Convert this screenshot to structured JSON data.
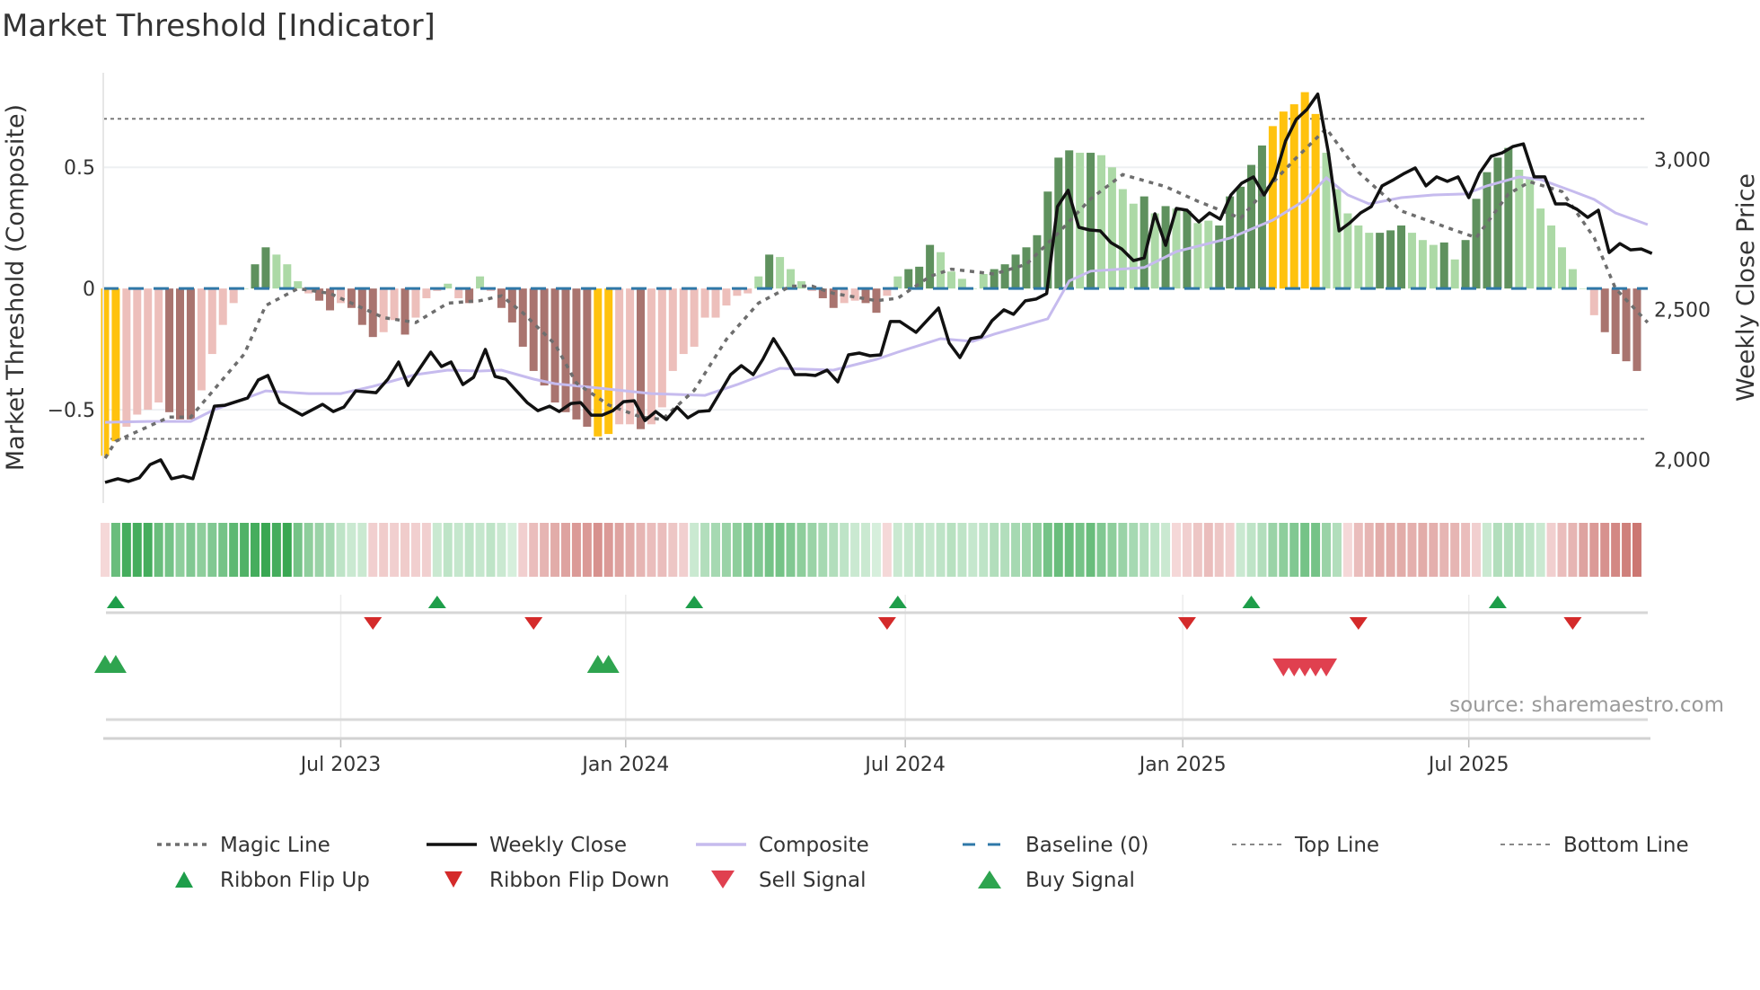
{
  "title": "Market Threshold [Indicator]",
  "source": "source: sharemaestro.com",
  "colors": {
    "yellow": "#FFC20E",
    "dark_green": "#5f915e",
    "light_green": "#acd9a6",
    "dark_red": "#a9746f",
    "light_red": "#edbfbb",
    "baseline": "#2f78a8",
    "magic": "#6e6e6e",
    "close": "#111111",
    "composite": "#c6bbee",
    "flip_up": "#1e9e4a",
    "flip_down": "#d42a2a",
    "buy": "#2ea44f",
    "sell": "#e0404f"
  },
  "chart_data": {
    "type": "bar",
    "title": "Market Threshold [Indicator]",
    "ylabel": "Market Threshold (Composite)",
    "y2label": "Weekly Close Price",
    "ylim": [
      -0.885,
      0.89
    ],
    "y2lim": [
      1855,
      3289
    ],
    "y_ticks": [
      {
        "v": 0.5,
        "label": "0.5"
      },
      {
        "v": 0,
        "label": "0"
      },
      {
        "v": -0.5,
        "label": "−0.5"
      }
    ],
    "y2_ticks": [
      {
        "v": 3000,
        "label": "3,000"
      },
      {
        "v": 2500,
        "label": "2,500"
      },
      {
        "v": 2000,
        "label": "2,000"
      }
    ],
    "x_unit": "week index",
    "x_ticks": [
      {
        "week": 22.0,
        "label": "Jul 2023"
      },
      {
        "week": 48.6,
        "label": "Jan 2024"
      },
      {
        "week": 74.7,
        "label": "Jul 2024"
      },
      {
        "week": 100.6,
        "label": "Jan 2025"
      },
      {
        "week": 127.3,
        "label": "Jul 2025"
      }
    ],
    "top_line": 0.7,
    "bottom_line": -0.62,
    "baseline": 0,
    "bars": {
      "values": [
        -0.69,
        -0.63,
        -0.57,
        -0.52,
        -0.5,
        -0.47,
        -0.51,
        -0.54,
        -0.54,
        -0.42,
        -0.27,
        -0.15,
        -0.06,
        0,
        0.1,
        0.17,
        0.14,
        0.1,
        0.03,
        -0.02,
        -0.05,
        -0.09,
        -0.06,
        -0.08,
        -0.15,
        -0.2,
        -0.18,
        -0.13,
        -0.19,
        -0.12,
        -0.04,
        -0.01,
        0.02,
        -0.04,
        -0.06,
        0.05,
        -0.01,
        -0.08,
        -0.14,
        -0.24,
        -0.34,
        -0.4,
        -0.47,
        -0.51,
        -0.54,
        -0.57,
        -0.61,
        -0.6,
        -0.56,
        -0.56,
        -0.58,
        -0.56,
        -0.49,
        -0.34,
        -0.27,
        -0.24,
        -0.12,
        -0.12,
        -0.07,
        -0.03,
        -0.02,
        0.05,
        0.14,
        0.13,
        0.08,
        0.03,
        -0.01,
        -0.04,
        -0.08,
        -0.06,
        -0.05,
        -0.06,
        -0.1,
        -0.03,
        0.05,
        0.08,
        0.09,
        0.18,
        0.15,
        0.07,
        0.04,
        0.0,
        0.06,
        0.08,
        0.1,
        0.14,
        0.17,
        0.22,
        0.4,
        0.54,
        0.57,
        0.56,
        0.56,
        0.55,
        0.5,
        0.41,
        0.35,
        0.38,
        0.31,
        0.34,
        0.33,
        0.32,
        0.27,
        0.28,
        0.26,
        0.38,
        0.42,
        0.51,
        0.59,
        0.67,
        0.73,
        0.76,
        0.81,
        0.72,
        0.56,
        0.41,
        0.31,
        0.26,
        0.23,
        0.23,
        0.24,
        0.26,
        0.23,
        0.2,
        0.18,
        0.19,
        0.12,
        0.2,
        0.37,
        0.48,
        0.54,
        0.58,
        0.49,
        0.46,
        0.33,
        0.26,
        0.17,
        0.08,
        0.0,
        -0.11,
        -0.18,
        -0.27,
        -0.3,
        -0.34
      ],
      "states": [
        "Y",
        "Y",
        "LR",
        "LR",
        "LR",
        "LR",
        "DR",
        "DR",
        "DR",
        "LR",
        "LR",
        "LR",
        "LR",
        "LG",
        "DG",
        "DG",
        "LG",
        "LG",
        "LG",
        "LR",
        "DR",
        "DR",
        "LR",
        "DR",
        "DR",
        "DR",
        "LR",
        "LR",
        "DR",
        "LR",
        "LR",
        "LR",
        "LG",
        "LR",
        "DR",
        "LG",
        "LR",
        "DR",
        "DR",
        "DR",
        "DR",
        "DR",
        "DR",
        "DR",
        "DR",
        "DR",
        "Y",
        "Y",
        "LR",
        "LR",
        "DR",
        "LR",
        "LR",
        "LR",
        "LR",
        "LR",
        "LR",
        "LR",
        "LR",
        "LR",
        "LR",
        "LG",
        "DG",
        "LG",
        "LG",
        "LG",
        "LR",
        "DR",
        "DR",
        "LR",
        "LR",
        "DR",
        "DR",
        "LR",
        "LG",
        "DG",
        "DG",
        "DG",
        "LG",
        "LG",
        "LG",
        "LG",
        "LG",
        "DG",
        "DG",
        "DG",
        "DG",
        "DG",
        "DG",
        "DG",
        "DG",
        "LG",
        "DG",
        "LG",
        "LG",
        "LG",
        "LG",
        "DG",
        "LG",
        "DG",
        "LG",
        "DG",
        "LG",
        "LG",
        "DG",
        "DG",
        "DG",
        "DG",
        "DG",
        "Y",
        "Y",
        "Y",
        "Y",
        "Y",
        "LG",
        "LG",
        "LG",
        "LG",
        "LG",
        "DG",
        "DG",
        "DG",
        "LG",
        "LG",
        "LG",
        "DG",
        "LG",
        "DG",
        "DG",
        "DG",
        "DG",
        "DG",
        "LG",
        "LG",
        "LG",
        "LG",
        "LG",
        "LG",
        "LG",
        "LR",
        "DR",
        "DR",
        "DR",
        "DR"
      ]
    },
    "ribbon": [
      -0.15,
      0.6,
      0.75,
      0.75,
      0.75,
      0.6,
      0.55,
      0.45,
      0.5,
      0.45,
      0.5,
      0.55,
      0.65,
      0.7,
      0.75,
      0.8,
      0.75,
      0.8,
      0.55,
      0.45,
      0.4,
      0.35,
      0.25,
      0.2,
      0.2,
      -0.2,
      -0.22,
      -0.2,
      -0.22,
      -0.2,
      -0.2,
      0.2,
      0.25,
      0.22,
      0.25,
      0.22,
      0.25,
      0.2,
      0.15,
      -0.2,
      -0.3,
      -0.35,
      -0.4,
      -0.45,
      -0.5,
      -0.5,
      -0.55,
      -0.5,
      -0.45,
      -0.4,
      -0.35,
      -0.3,
      -0.3,
      -0.25,
      -0.2,
      0.2,
      0.3,
      0.35,
      0.4,
      0.45,
      0.5,
      0.5,
      0.55,
      0.55,
      0.5,
      0.45,
      0.4,
      0.35,
      0.3,
      0.25,
      0.2,
      0.2,
      0.15,
      -0.15,
      0.2,
      0.22,
      0.25,
      0.22,
      0.25,
      0.28,
      0.25,
      0.22,
      0.25,
      0.3,
      0.3,
      0.35,
      0.38,
      0.45,
      0.55,
      0.6,
      0.6,
      0.55,
      0.6,
      0.5,
      0.45,
      0.4,
      0.35,
      0.3,
      0.25,
      0.2,
      -0.15,
      -0.2,
      -0.25,
      -0.3,
      -0.25,
      -0.2,
      0.2,
      0.25,
      0.3,
      0.4,
      0.45,
      0.5,
      0.55,
      0.55,
      0.4,
      0.3,
      -0.15,
      -0.3,
      -0.35,
      -0.4,
      -0.4,
      -0.4,
      -0.38,
      -0.4,
      -0.38,
      -0.35,
      -0.35,
      -0.3,
      -0.2,
      0.2,
      0.3,
      0.3,
      0.3,
      0.25,
      0.2,
      -0.2,
      -0.3,
      -0.35,
      -0.45,
      -0.5,
      -0.55,
      -0.6,
      -0.65,
      -0.7
    ],
    "weekly_close": [
      [
        0,
        1924
      ],
      [
        1.2,
        1936
      ],
      [
        2.2,
        1927
      ],
      [
        3.2,
        1939
      ],
      [
        4.2,
        1983
      ],
      [
        5.2,
        1999
      ],
      [
        6.2,
        1936
      ],
      [
        7.3,
        1945
      ],
      [
        8.2,
        1936
      ],
      [
        10.2,
        2178
      ],
      [
        11.2,
        2181
      ],
      [
        13.3,
        2205
      ],
      [
        14.3,
        2265
      ],
      [
        15.2,
        2280
      ],
      [
        16.3,
        2190
      ],
      [
        18.4,
        2148
      ],
      [
        20.3,
        2184
      ],
      [
        21.3,
        2160
      ],
      [
        22.3,
        2175
      ],
      [
        23.4,
        2229
      ],
      [
        25.3,
        2223
      ],
      [
        26.4,
        2268
      ],
      [
        27.4,
        2325
      ],
      [
        28.3,
        2247
      ],
      [
        30.4,
        2358
      ],
      [
        31.4,
        2310
      ],
      [
        32.3,
        2325
      ],
      [
        33.4,
        2250
      ],
      [
        34.4,
        2274
      ],
      [
        35.5,
        2367
      ],
      [
        36.4,
        2277
      ],
      [
        37.4,
        2268
      ],
      [
        39.4,
        2190
      ],
      [
        40.4,
        2163
      ],
      [
        41.5,
        2178
      ],
      [
        42.4,
        2160
      ],
      [
        43.5,
        2187
      ],
      [
        44.4,
        2190
      ],
      [
        45.4,
        2148
      ],
      [
        46.4,
        2148
      ],
      [
        47.4,
        2163
      ],
      [
        48.4,
        2193
      ],
      [
        49.4,
        2196
      ],
      [
        50.4,
        2130
      ],
      [
        51.4,
        2160
      ],
      [
        52.4,
        2133
      ],
      [
        53.4,
        2175
      ],
      [
        54.4,
        2139
      ],
      [
        55.4,
        2160
      ],
      [
        56.4,
        2163
      ],
      [
        57.5,
        2229
      ],
      [
        58.4,
        2283
      ],
      [
        59.4,
        2313
      ],
      [
        60.5,
        2283
      ],
      [
        61.4,
        2334
      ],
      [
        62.4,
        2403
      ],
      [
        63.5,
        2340
      ],
      [
        64.4,
        2283
      ],
      [
        65.4,
        2283
      ],
      [
        66.3,
        2280
      ],
      [
        67.4,
        2298
      ],
      [
        68.4,
        2259
      ],
      [
        69.4,
        2349
      ],
      [
        70.4,
        2355
      ],
      [
        71.4,
        2346
      ],
      [
        72.4,
        2349
      ],
      [
        73.3,
        2460
      ],
      [
        74.2,
        2460
      ],
      [
        75.7,
        2424
      ],
      [
        77.8,
        2505
      ],
      [
        78.8,
        2388
      ],
      [
        79.8,
        2340
      ],
      [
        80.8,
        2403
      ],
      [
        81.8,
        2409
      ],
      [
        82.8,
        2463
      ],
      [
        83.9,
        2499
      ],
      [
        84.8,
        2484
      ],
      [
        85.9,
        2529
      ],
      [
        86.9,
        2535
      ],
      [
        87.9,
        2553
      ],
      [
        88.9,
        2843
      ],
      [
        89.9,
        2897
      ],
      [
        90.9,
        2774
      ],
      [
        91.9,
        2765
      ],
      [
        92.9,
        2762
      ],
      [
        93.9,
        2723
      ],
      [
        94.9,
        2702
      ],
      [
        96,
        2663
      ],
      [
        97,
        2672
      ],
      [
        98,
        2819
      ],
      [
        99,
        2714
      ],
      [
        100,
        2837
      ],
      [
        101,
        2831
      ],
      [
        102.1,
        2792
      ],
      [
        103.1,
        2822
      ],
      [
        104.1,
        2801
      ],
      [
        105.1,
        2882
      ],
      [
        106.1,
        2921
      ],
      [
        107.2,
        2942
      ],
      [
        108.2,
        2882
      ],
      [
        109.2,
        2942
      ],
      [
        110.2,
        3062
      ],
      [
        111.2,
        3134
      ],
      [
        112.2,
        3167
      ],
      [
        113.2,
        3218
      ],
      [
        114.2,
        3022
      ],
      [
        115.2,
        2762
      ],
      [
        116.2,
        2789
      ],
      [
        117.2,
        2822
      ],
      [
        118.2,
        2843
      ],
      [
        119.2,
        2912
      ],
      [
        120.3,
        2933
      ],
      [
        121.3,
        2954
      ],
      [
        122.3,
        2972
      ],
      [
        123.3,
        2912
      ],
      [
        124.3,
        2942
      ],
      [
        125.3,
        2927
      ],
      [
        126.3,
        2942
      ],
      [
        127.3,
        2873
      ],
      [
        128.3,
        2954
      ],
      [
        129.4,
        3011
      ],
      [
        130.4,
        3022
      ],
      [
        131.4,
        3043
      ],
      [
        132.4,
        3052
      ],
      [
        133.4,
        2942
      ],
      [
        134.4,
        2942
      ],
      [
        135.4,
        2852
      ],
      [
        136.4,
        2852
      ],
      [
        137.4,
        2834
      ],
      [
        138.4,
        2807
      ],
      [
        139.4,
        2831
      ],
      [
        140.4,
        2690
      ],
      [
        141.4,
        2720
      ],
      [
        142.4,
        2699
      ],
      [
        143.4,
        2702
      ],
      [
        144.4,
        2687
      ]
    ],
    "composite": [
      [
        0,
        2124
      ],
      [
        4,
        2127
      ],
      [
        8,
        2127
      ],
      [
        10,
        2163
      ],
      [
        15,
        2229
      ],
      [
        19,
        2220
      ],
      [
        22,
        2220
      ],
      [
        25,
        2244
      ],
      [
        29,
        2283
      ],
      [
        32,
        2298
      ],
      [
        35,
        2295
      ],
      [
        37,
        2298
      ],
      [
        40,
        2268
      ],
      [
        42,
        2253
      ],
      [
        47,
        2235
      ],
      [
        51,
        2220
      ],
      [
        56,
        2214
      ],
      [
        59,
        2250
      ],
      [
        63,
        2304
      ],
      [
        68,
        2298
      ],
      [
        72,
        2334
      ],
      [
        74,
        2358
      ],
      [
        78,
        2403
      ],
      [
        81,
        2394
      ],
      [
        83,
        2418
      ],
      [
        88,
        2469
      ],
      [
        90,
        2595
      ],
      [
        92,
        2628
      ],
      [
        97,
        2640
      ],
      [
        100,
        2693
      ],
      [
        105,
        2738
      ],
      [
        109,
        2798
      ],
      [
        112,
        2864
      ],
      [
        114,
        2939
      ],
      [
        116,
        2882
      ],
      [
        118,
        2852
      ],
      [
        121,
        2873
      ],
      [
        124,
        2882
      ],
      [
        127,
        2885
      ],
      [
        129,
        2912
      ],
      [
        132,
        2942
      ],
      [
        134,
        2933
      ],
      [
        137,
        2894
      ],
      [
        139,
        2867
      ],
      [
        141,
        2822
      ],
      [
        144,
        2783
      ]
    ],
    "magic_line": [
      [
        0,
        -0.7
      ],
      [
        1,
        -0.63
      ],
      [
        6,
        -0.53
      ],
      [
        8,
        -0.53
      ],
      [
        13,
        -0.27
      ],
      [
        15,
        -0.07
      ],
      [
        18,
        0.0
      ],
      [
        21,
        -0.02
      ],
      [
        24,
        -0.08
      ],
      [
        26,
        -0.12
      ],
      [
        29,
        -0.14
      ],
      [
        32,
        -0.06
      ],
      [
        35,
        -0.05
      ],
      [
        37,
        -0.03
      ],
      [
        39,
        -0.1
      ],
      [
        42,
        -0.23
      ],
      [
        44,
        -0.39
      ],
      [
        47,
        -0.48
      ],
      [
        50,
        -0.53
      ],
      [
        52,
        -0.54
      ],
      [
        55,
        -0.42
      ],
      [
        58,
        -0.21
      ],
      [
        61,
        -0.06
      ],
      [
        64,
        0.01
      ],
      [
        66,
        0.01
      ],
      [
        68,
        -0.02
      ],
      [
        72,
        -0.05
      ],
      [
        74,
        -0.04
      ],
      [
        77,
        0.05
      ],
      [
        79,
        0.08
      ],
      [
        83,
        0.06
      ],
      [
        86,
        0.1
      ],
      [
        89,
        0.23
      ],
      [
        92,
        0.37
      ],
      [
        95,
        0.47
      ],
      [
        99,
        0.42
      ],
      [
        102,
        0.36
      ],
      [
        106,
        0.29
      ],
      [
        108,
        0.39
      ],
      [
        111,
        0.53
      ],
      [
        114,
        0.66
      ],
      [
        117,
        0.48
      ],
      [
        121,
        0.32
      ],
      [
        126,
        0.24
      ],
      [
        128,
        0.21
      ],
      [
        131,
        0.39
      ],
      [
        133,
        0.44
      ],
      [
        136,
        0.4
      ],
      [
        139,
        0.21
      ],
      [
        141,
        0.0
      ],
      [
        144,
        -0.14
      ]
    ],
    "ribbon_flip_up": [
      1,
      31,
      55,
      74,
      107,
      130
    ],
    "ribbon_flip_down": [
      25,
      40,
      73,
      101,
      117,
      137
    ],
    "buy_signals": [
      0,
      1,
      46,
      47
    ],
    "sell_signals": [
      110,
      111,
      112,
      113,
      114
    ],
    "legend": {
      "placement": "bottom",
      "items": [
        {
          "key": "magic",
          "label": "Magic Line"
        },
        {
          "key": "close",
          "label": "Weekly Close"
        },
        {
          "key": "composite",
          "label": "Composite"
        },
        {
          "key": "baseline",
          "label": "Baseline (0)"
        },
        {
          "key": "top",
          "label": "Top Line"
        },
        {
          "key": "bottom",
          "label": "Bottom Line"
        },
        {
          "key": "flip_up",
          "label": "Ribbon Flip Up"
        },
        {
          "key": "flip_down",
          "label": "Ribbon Flip Down"
        },
        {
          "key": "sell",
          "label": "Sell Signal"
        },
        {
          "key": "buy",
          "label": "Buy Signal"
        }
      ]
    }
  }
}
